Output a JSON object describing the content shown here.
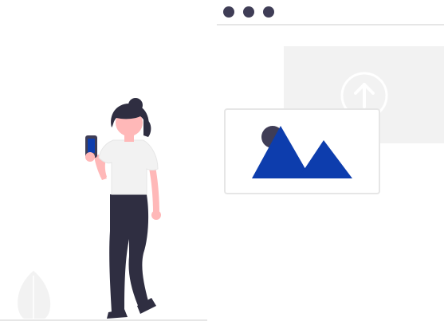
{
  "illustration": {
    "type": "image-upload-illustration",
    "window": {
      "dots": 3,
      "dot_color": "#3f3d56",
      "titlebar_line_color": "#e6e6e6"
    },
    "upload_panel": {
      "color": "#f2f2f2",
      "icon": "upload-arrow-icon",
      "icon_color": "#ffffff"
    },
    "image_card": {
      "card_color": "#ffffff",
      "border_color": "#e6e6e6",
      "mountain_color": "#0d3dad",
      "sun_color": "#3f3d56",
      "icon": "image-placeholder-icon"
    },
    "person": {
      "hair_color": "#2f2e41",
      "skin_color": "#ffb8b8",
      "shirt_color": "#f2f2f2",
      "pants_color": "#2f2e41",
      "phone_color": "#3f3d56",
      "phone_screen_color": "#0d3dad"
    },
    "plant": {
      "color": "#f2f2f2"
    },
    "ground_color": "#e6e6e6"
  }
}
